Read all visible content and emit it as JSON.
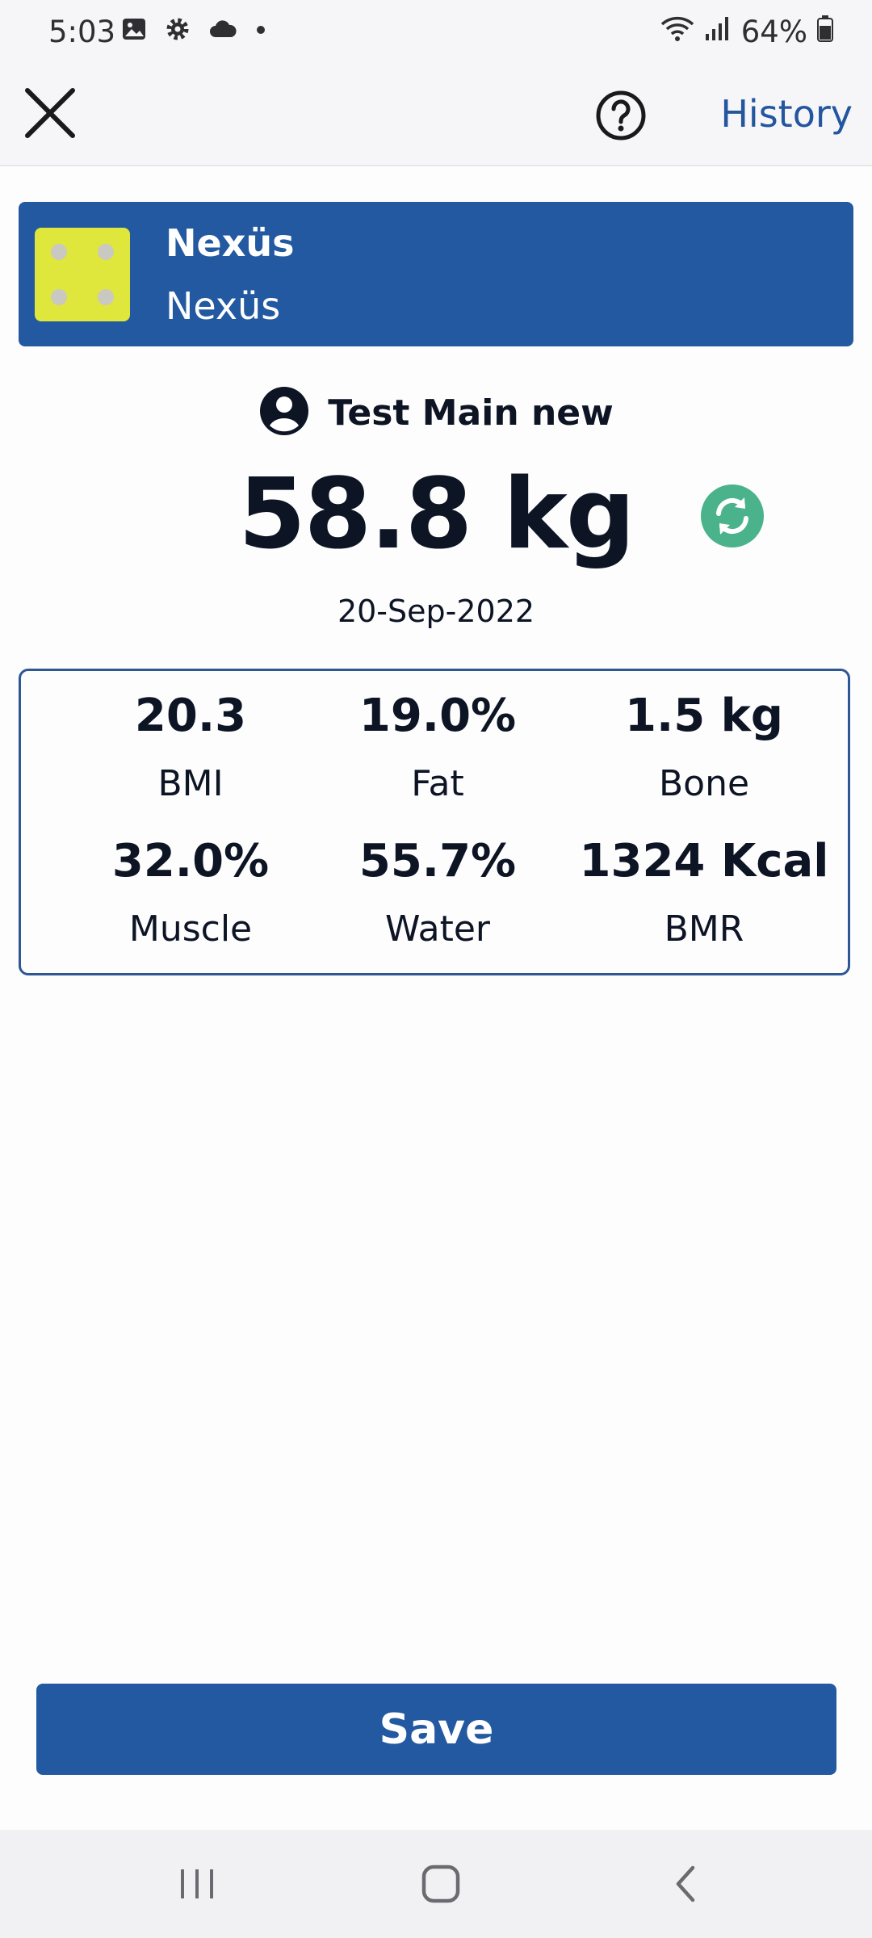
{
  "status_bar": {
    "time": "5:03",
    "battery": "64%",
    "icons": [
      "gallery-icon",
      "settings-gear-icon",
      "cloud-icon",
      "dot-icon",
      "wifi-icon",
      "signal-icon",
      "battery-icon"
    ]
  },
  "app_bar": {
    "close_icon": "close-icon",
    "help_icon": "help-icon",
    "history_label": "History"
  },
  "device": {
    "name_primary": "Nexüs",
    "name_secondary": "Nexüs",
    "thumbnail_color": "#dfe63c"
  },
  "user": {
    "name": "Test Main new",
    "icon": "account-circle-icon"
  },
  "measurement": {
    "weight": "58.8 kg",
    "date": "20-Sep-2022",
    "sync_icon": "sync-icon"
  },
  "metrics": [
    {
      "value": "20.3",
      "label": "BMI"
    },
    {
      "value": "19.0%",
      "label": "Fat"
    },
    {
      "value": "1.5 kg",
      "label": "Bone"
    },
    {
      "value": "32.0%",
      "label": "Muscle"
    },
    {
      "value": "55.7%",
      "label": "Water"
    },
    {
      "value": "1324 Kcal",
      "label": "BMR"
    }
  ],
  "actions": {
    "save_label": "Save"
  },
  "colors": {
    "primary": "#2359a1",
    "accent_green": "#4bb38b",
    "link": "#2456a0",
    "text": "#0d1424"
  }
}
